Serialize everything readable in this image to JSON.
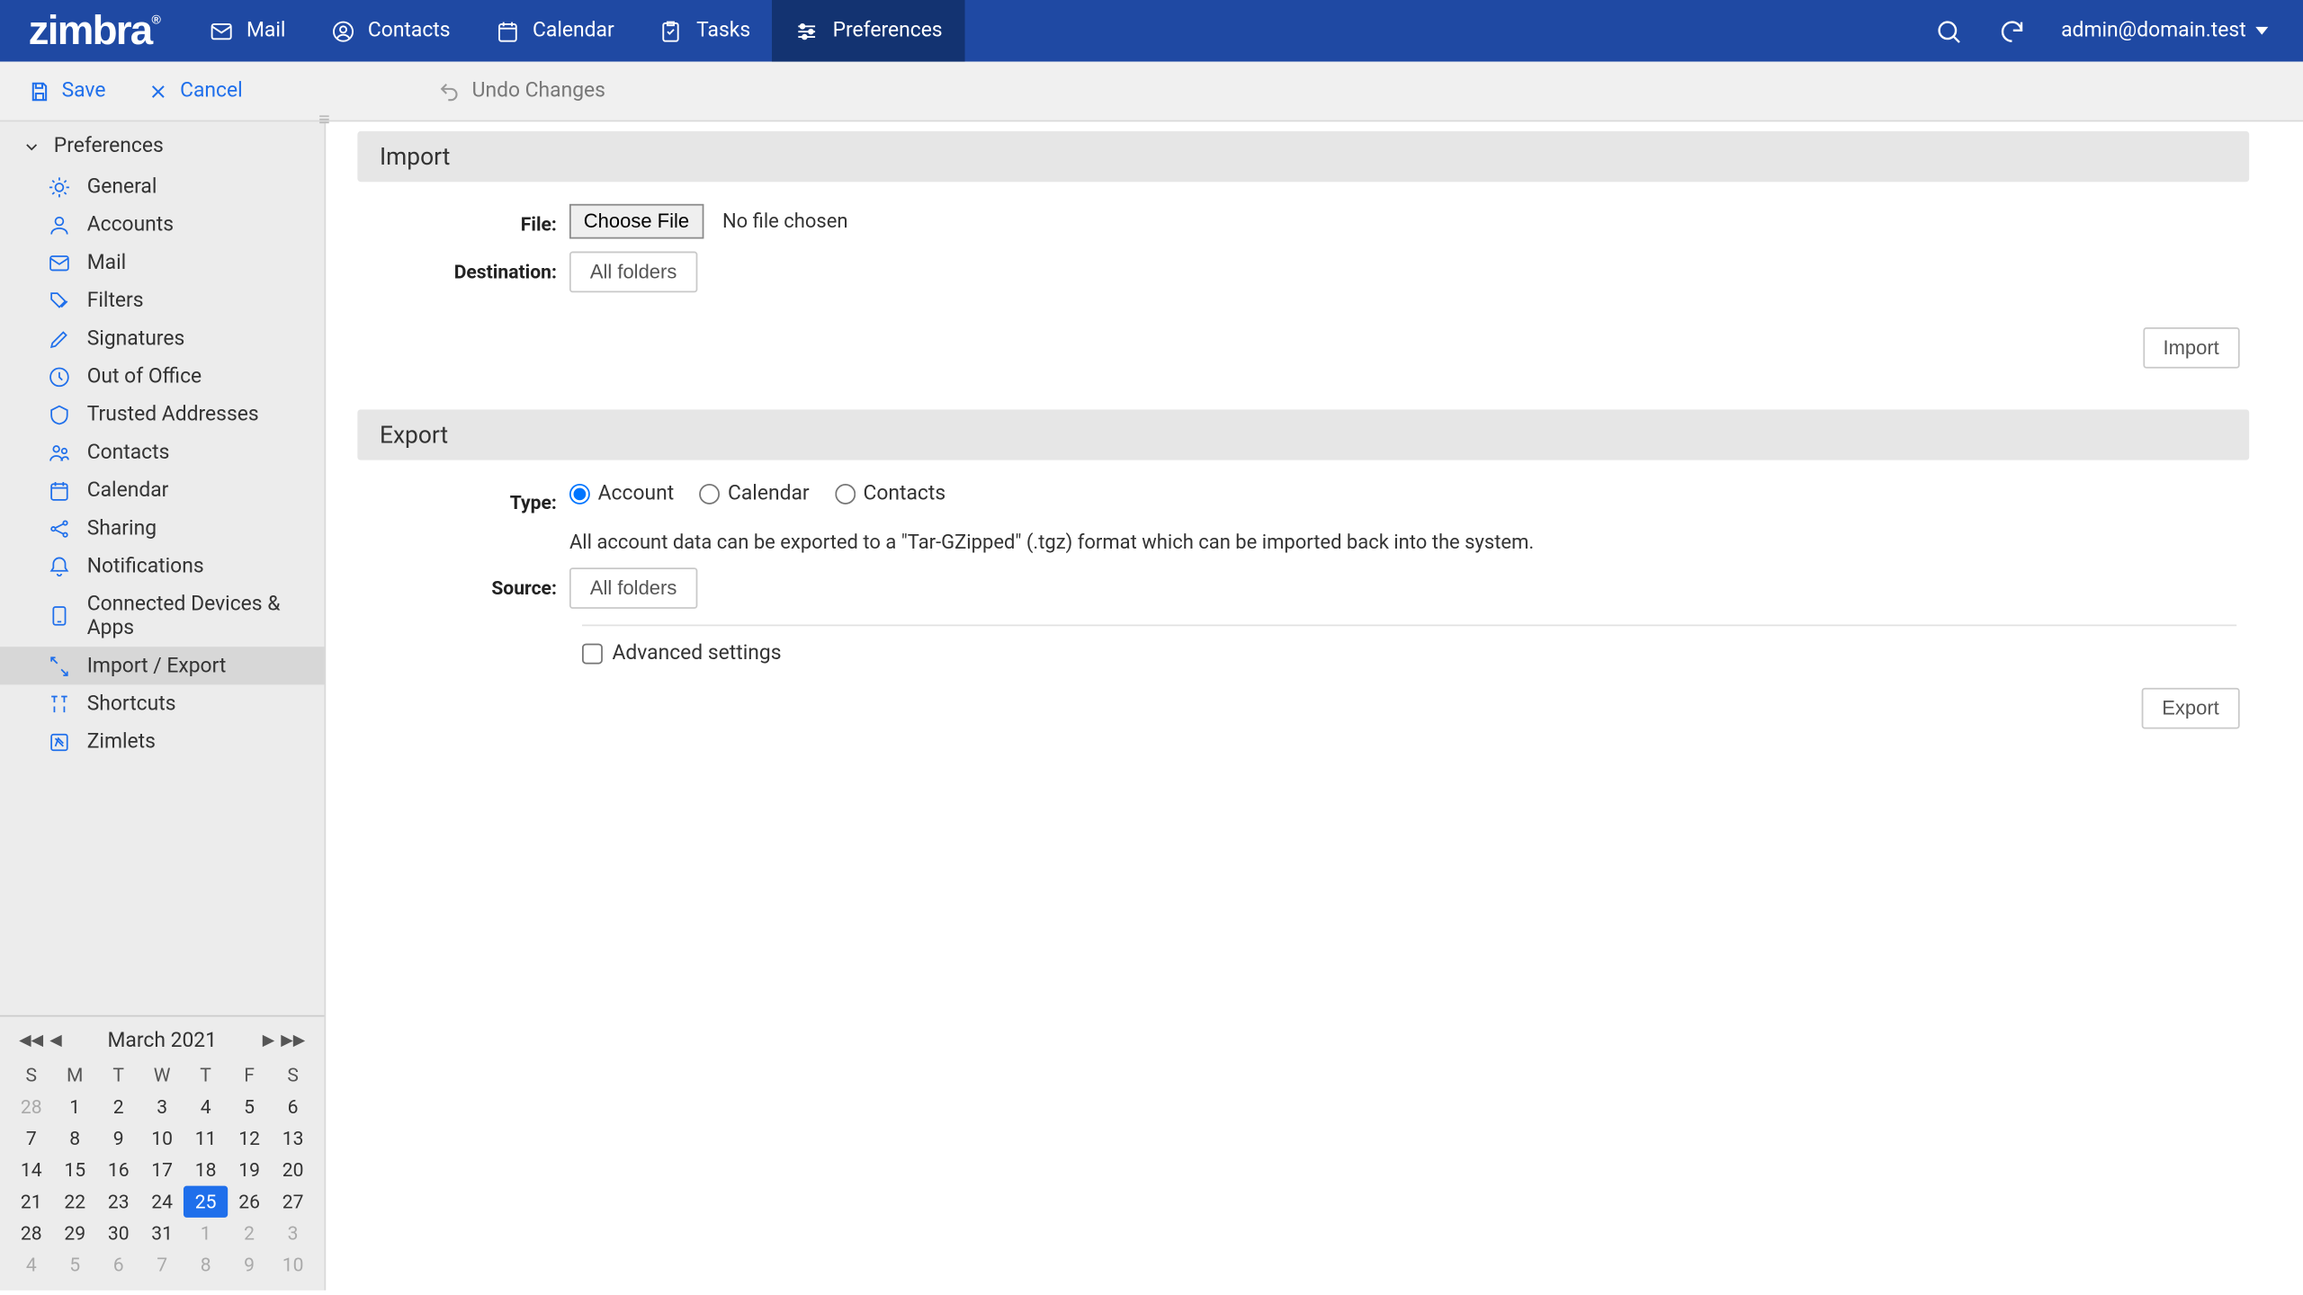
{
  "brand": "zimbra",
  "nav": {
    "mail": "Mail",
    "contacts": "Contacts",
    "calendar": "Calendar",
    "tasks": "Tasks",
    "preferences": "Preferences"
  },
  "user": "admin@domain.test",
  "actions": {
    "save": "Save",
    "cancel": "Cancel",
    "undo": "Undo Changes"
  },
  "sidebar": {
    "header": "Preferences",
    "items": [
      "General",
      "Accounts",
      "Mail",
      "Filters",
      "Signatures",
      "Out of Office",
      "Trusted Addresses",
      "Contacts",
      "Calendar",
      "Sharing",
      "Notifications",
      "Connected Devices & Apps",
      "Import / Export",
      "Shortcuts",
      "Zimlets"
    ],
    "selected_index": 12
  },
  "import": {
    "title": "Import",
    "file_label": "File:",
    "choose_file": "Choose File",
    "no_file": "No file chosen",
    "destination_label": "Destination:",
    "destination_value": "All folders",
    "action": "Import"
  },
  "export": {
    "title": "Export",
    "type_label": "Type:",
    "types": {
      "account": "Account",
      "calendar": "Calendar",
      "contacts": "Contacts"
    },
    "help": "All account data can be exported to a \"Tar-GZipped\" (.tgz) format which can be imported back into the system.",
    "source_label": "Source:",
    "source_value": "All folders",
    "advanced": "Advanced settings",
    "action": "Export"
  },
  "calendar": {
    "title": "March 2021",
    "dow": [
      "S",
      "M",
      "T",
      "W",
      "T",
      "F",
      "S"
    ],
    "weeks": [
      [
        {
          "d": 28,
          "off": true
        },
        {
          "d": 1
        },
        {
          "d": 2
        },
        {
          "d": 3
        },
        {
          "d": 4
        },
        {
          "d": 5
        },
        {
          "d": 6
        }
      ],
      [
        {
          "d": 7
        },
        {
          "d": 8
        },
        {
          "d": 9
        },
        {
          "d": 10
        },
        {
          "d": 11
        },
        {
          "d": 12
        },
        {
          "d": 13
        }
      ],
      [
        {
          "d": 14
        },
        {
          "d": 15
        },
        {
          "d": 16
        },
        {
          "d": 17
        },
        {
          "d": 18
        },
        {
          "d": 19
        },
        {
          "d": 20
        }
      ],
      [
        {
          "d": 21
        },
        {
          "d": 22
        },
        {
          "d": 23
        },
        {
          "d": 24
        },
        {
          "d": 25,
          "today": true
        },
        {
          "d": 26
        },
        {
          "d": 27
        }
      ],
      [
        {
          "d": 28
        },
        {
          "d": 29
        },
        {
          "d": 30
        },
        {
          "d": 31
        },
        {
          "d": 1,
          "off": true
        },
        {
          "d": 2,
          "off": true
        },
        {
          "d": 3,
          "off": true
        }
      ],
      [
        {
          "d": 4,
          "off": true
        },
        {
          "d": 5,
          "off": true
        },
        {
          "d": 6,
          "off": true
        },
        {
          "d": 7,
          "off": true
        },
        {
          "d": 8,
          "off": true
        },
        {
          "d": 9,
          "off": true
        },
        {
          "d": 10,
          "off": true
        }
      ]
    ]
  }
}
